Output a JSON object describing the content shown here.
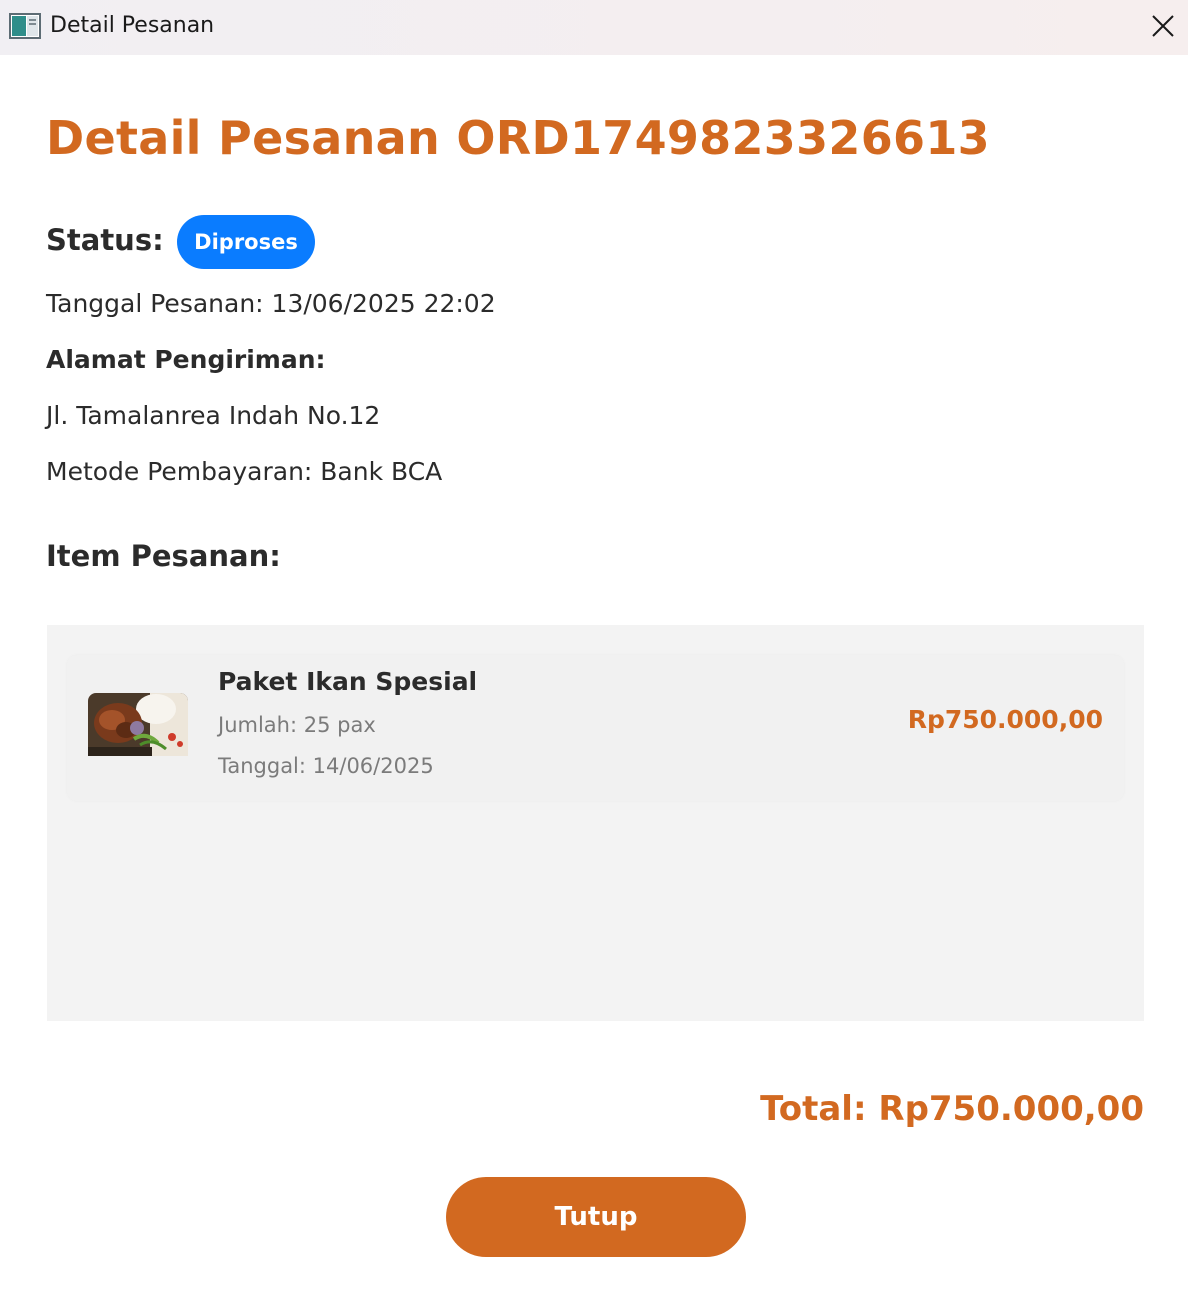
{
  "window": {
    "title": "Detail Pesanan"
  },
  "order": {
    "heading": "Detail Pesanan ORD1749823326613",
    "status_label": "Status:",
    "status_value": "Diproses",
    "order_date": "Tanggal Pesanan: 13/06/2025 22:02",
    "address_label": "Alamat Pengiriman:",
    "address": "Jl. Tamalanrea Indah No.12",
    "payment_method": "Metode Pembayaran: Bank BCA",
    "items_label": "Item Pesanan:",
    "items": [
      {
        "name": "Paket Ikan Spesial",
        "quantity": "Jumlah: 25 pax",
        "date": "Tanggal: 14/06/2025",
        "price": "Rp750.000,00"
      }
    ],
    "total": "Total: Rp750.000,00"
  },
  "actions": {
    "close_label": "Tutup"
  },
  "colors": {
    "accent": "#d26920",
    "status_badge": "#0a7cff",
    "panel": "#f3f3f3"
  },
  "icons": {
    "app": "app-window-icon",
    "close": "close-icon",
    "item_image": "food-photo-image"
  }
}
